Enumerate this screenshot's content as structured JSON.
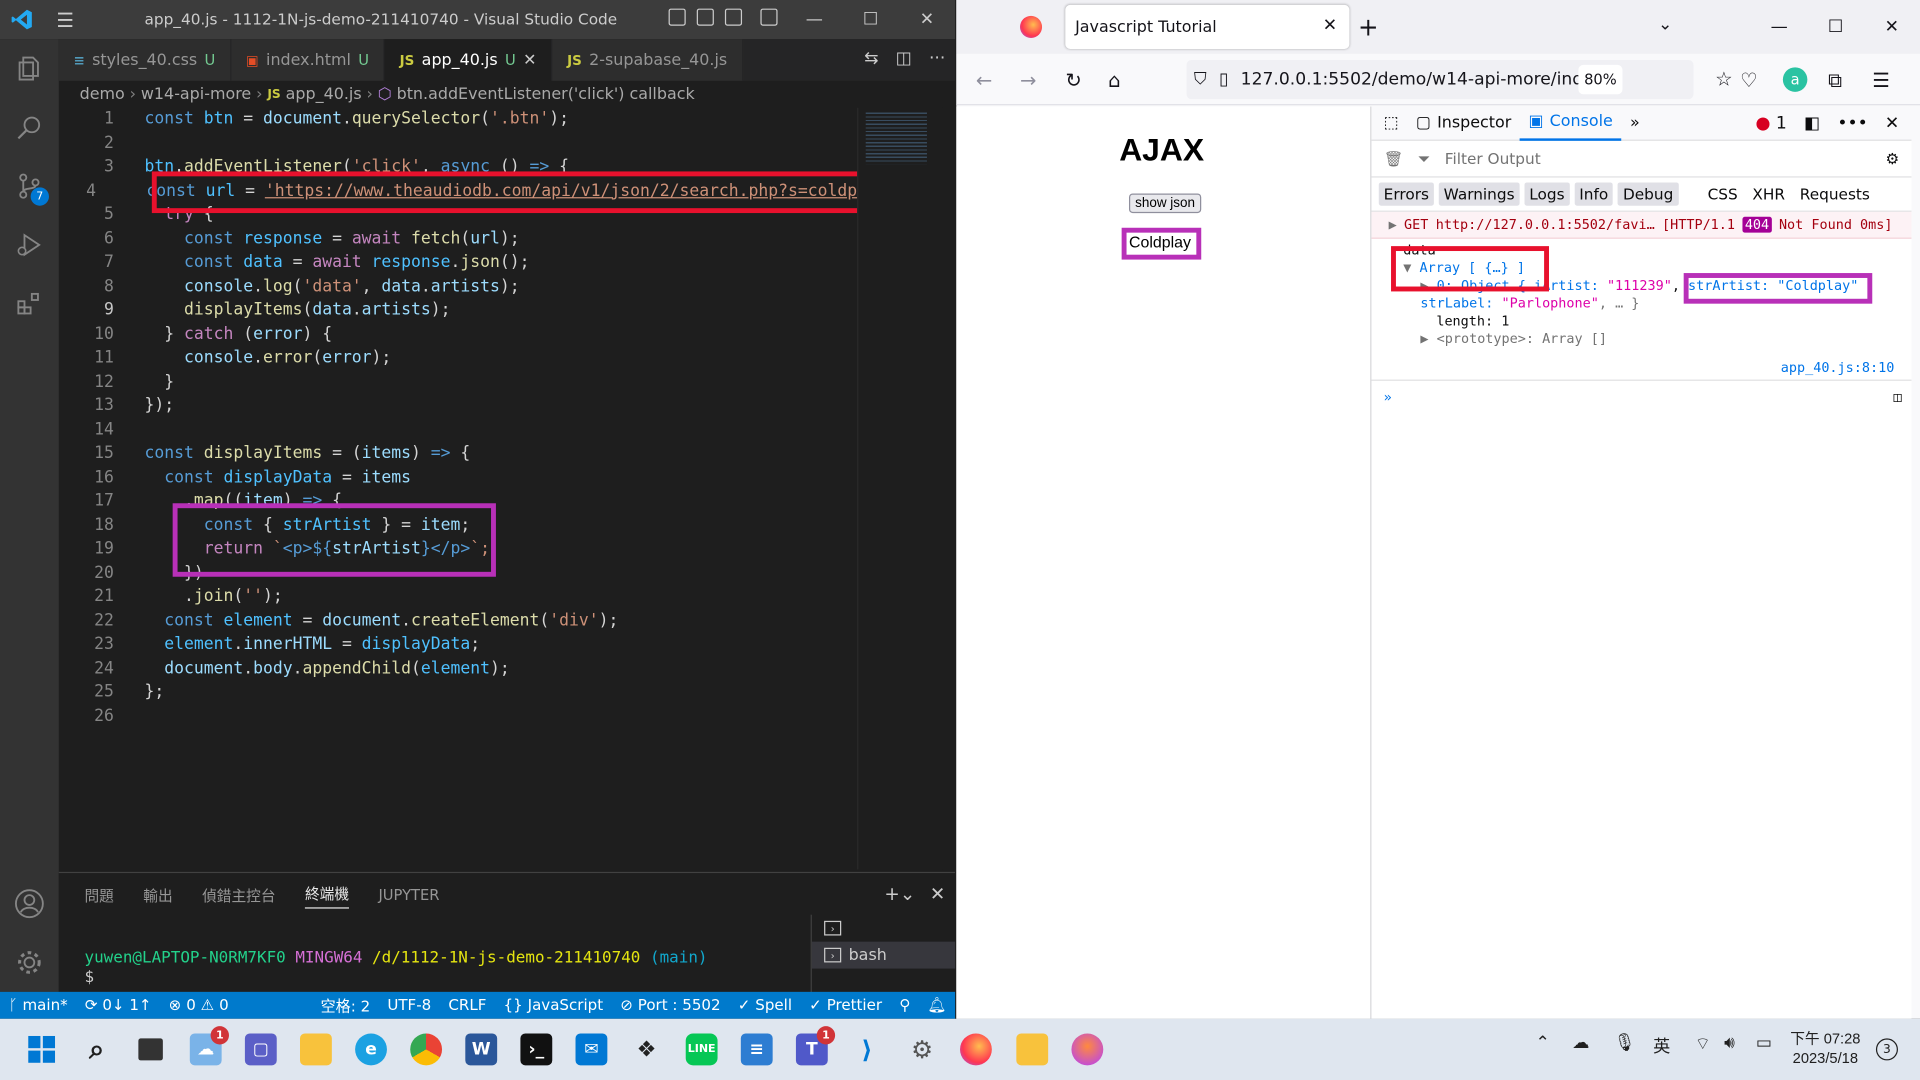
{
  "vscode": {
    "window_title": "app_40.js - 1112-1N-js-demo-211410740 - Visual Studio Code",
    "scm_badge": "7",
    "tabs": [
      {
        "label": "styles_40.css",
        "icon": "css-file-icon",
        "status": "U"
      },
      {
        "label": "index.html",
        "icon": "html-file-icon",
        "status": "U"
      },
      {
        "label": "app_40.js",
        "icon": "js-file-icon",
        "status": "U"
      },
      {
        "label": "2-supabase_40.js",
        "icon": "js-file-icon",
        "status": ""
      }
    ],
    "breadcrumb": [
      "demo",
      "w14-api-more",
      "app_40.js",
      "btn.addEventListener('click') callback"
    ],
    "line_numbers": [
      "1",
      "2",
      "3",
      "4",
      "5",
      "6",
      "7",
      "8",
      "9",
      "10",
      "11",
      "12",
      "13",
      "14",
      "15",
      "16",
      "17",
      "18",
      "19",
      "20",
      "21",
      "22",
      "23",
      "24",
      "25",
      "26"
    ],
    "current_line": "9",
    "code": {
      "l1": [
        "const",
        " btn",
        " = ",
        "document",
        ".",
        "querySelector",
        "(",
        "'.btn'",
        ");"
      ],
      "l3": [
        "btn",
        ".",
        "addEventListener",
        "(",
        "'click'",
        ", ",
        "async",
        " () ",
        "=>",
        " {"
      ],
      "l4": [
        "  ",
        "const",
        " url",
        " = ",
        "'https://www.theaudiodb.com/api/v1/json/2/search.php?s=coldp"
      ],
      "l5": [
        "  ",
        "try",
        " {"
      ],
      "l6": [
        "    ",
        "const",
        " response",
        " = ",
        "await",
        " fetch",
        "(",
        "url",
        ");"
      ],
      "l7": [
        "    ",
        "const",
        " data",
        " = ",
        "await",
        " response",
        ".",
        "json",
        "();"
      ],
      "l8": [
        "    ",
        "console",
        ".",
        "log",
        "(",
        "'data'",
        ", ",
        "data",
        ".",
        "artists",
        ");"
      ],
      "l9": [
        "    ",
        "displayItems",
        "(",
        "data",
        ".",
        "artists",
        ");"
      ],
      "l10": [
        "  ",
        "} ",
        "catch",
        " (",
        "error",
        ") {"
      ],
      "l11": [
        "    ",
        "console",
        ".",
        "error",
        "(",
        "error",
        ");"
      ],
      "l12": [
        "  ",
        "}"
      ],
      "l13": [
        "});"
      ],
      "l15": [
        "const",
        " displayItems",
        " = (",
        "items",
        ") ",
        "=>",
        " {"
      ],
      "l16": [
        "  ",
        "const",
        " displayData",
        " = ",
        "items"
      ],
      "l17": [
        "    .",
        "map",
        "((",
        "item",
        ") ",
        "=>",
        " {"
      ],
      "l18": [
        "      ",
        "const",
        " { ",
        "strArtist",
        " } = ",
        "item",
        ";"
      ],
      "l19": [
        "      ",
        "return",
        " `",
        "<p>",
        "${",
        "strArtist",
        "}",
        "</p>",
        "`;"
      ],
      "l20": [
        "    })"
      ],
      "l21": [
        "    .",
        "join",
        "(",
        "''",
        ");"
      ],
      "l22": [
        "  ",
        "const",
        " element",
        " = ",
        "document",
        ".",
        "createElement",
        "(",
        "'div'",
        ");"
      ],
      "l23": [
        "  ",
        "element",
        ".",
        "innerHTML",
        " = ",
        "displayData",
        ";"
      ],
      "l24": [
        "  ",
        "document",
        ".",
        "body",
        ".",
        "appendChild",
        "(",
        "element",
        ");"
      ],
      "l25": [
        "};"
      ]
    },
    "panel_tabs": [
      "問題",
      "輸出",
      "偵錯主控台",
      "終端機",
      "JUPYTER"
    ],
    "active_panel_tab": "終端機",
    "terminal": {
      "user": "yuwen@LAPTOP-N0RM7KF0",
      "env": "MINGW64",
      "path": "/d/1112-1N-js-demo-211410740",
      "branch": "(main)",
      "prompt": "$"
    },
    "terminal_list": [
      {
        "label": ""
      },
      {
        "label": "bash"
      }
    ],
    "status": {
      "branch": "main*",
      "sync": "0↓ 1↑",
      "errors": "0",
      "warnings": "0",
      "spaces": "空格: 2",
      "encoding": "UTF-8",
      "eol": "CRLF",
      "language": "JavaScript",
      "port": "Port : 5502",
      "spell": "Spell",
      "prettier": "Prettier"
    }
  },
  "firefox": {
    "tab_title": "Javascript Tutorial",
    "url": "127.0.0.1:5502/demo/w14-api-more/ind",
    "zoom": "80%",
    "page": {
      "heading": "AJAX",
      "button": "show json",
      "result": "Coldplay"
    },
    "devtools": {
      "tabs": [
        "Inspector",
        "Console"
      ],
      "active_tab": "Console",
      "error_count": "1",
      "filter_placeholder": "Filter Output",
      "levels": [
        "Errors",
        "Warnings",
        "Logs",
        "Info",
        "Debug"
      ],
      "levels_on": [
        "Errors",
        "Warnings",
        "Logs",
        "Info",
        "Debug"
      ],
      "types": [
        "CSS",
        "XHR",
        "Requests"
      ],
      "error_msg": {
        "method": "GET",
        "url": "http://127.0.0.1:5502/favi…",
        "proto": "[HTTP/1.1",
        "code": "404",
        "rest": "Not Found 0ms]"
      },
      "log": {
        "label": "data",
        "array": "Array [ {…} ]",
        "obj_prefix": "0: Object { i",
        "obj_artist_key": "Artist:",
        "obj_artist_val": "\"111239\"",
        "str_artist": "strArtist: \"Coldplay\"",
        "label_key": "strLabel:",
        "label_val": "\"Parlophone\"",
        "label_rest": ", … }",
        "length": "length: 1",
        "proto": "<prototype>: Array []",
        "source": "app_40.js:8:10"
      },
      "prompt": "»"
    }
  },
  "taskbar": {
    "notification_badge": "1",
    "teams_badge": "1",
    "ime": "英",
    "time": "下午 07:28",
    "date": "2023/5/18",
    "notif_count": "3"
  }
}
